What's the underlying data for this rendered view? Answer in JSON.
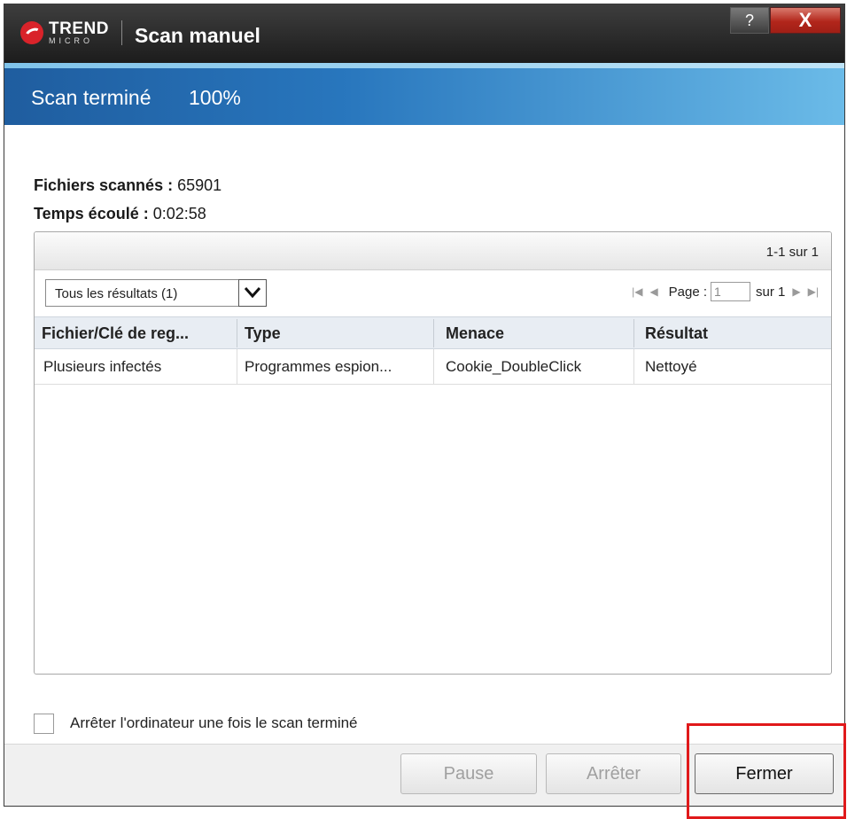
{
  "window": {
    "brand_top": "TREND",
    "brand_bottom": "MICRO",
    "title": "Scan manuel",
    "help_label": "?",
    "close_label": "X"
  },
  "status": {
    "label": "Scan terminé",
    "percent": "100%",
    "progress": 1.0
  },
  "info": {
    "files_label": "Fichiers scannés :",
    "files_value": "65901",
    "elapsed_label": "Temps écoulé :",
    "elapsed_value": "0:02:58"
  },
  "results": {
    "range_text": "1-1 sur 1",
    "filter_selected": "Tous les résultats (1)",
    "page_label": "Page :",
    "page_value": "1",
    "page_total": "sur 1",
    "columns": [
      "Fichier/Clé de reg...",
      "Type",
      "Menace",
      "Résultat"
    ],
    "rows": [
      [
        "Plusieurs infectés",
        "Programmes espion...",
        "Cookie_DoubleClick",
        "Nettoyé"
      ]
    ]
  },
  "options": {
    "shutdown_label": "Arrêter l'ordinateur une fois le scan terminé",
    "shutdown_checked": false
  },
  "buttons": {
    "pause": "Pause",
    "stop": "Arrêter",
    "close": "Fermer"
  },
  "colors": {
    "titlebar": "#1c1c1c",
    "status_band": "#2876bd",
    "close_button": "#b2261b",
    "highlight": "#e0191b"
  }
}
